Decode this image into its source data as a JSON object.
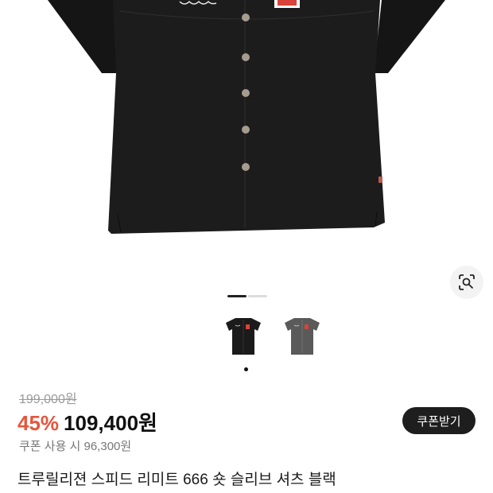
{
  "product": {
    "original_price": "199,000원",
    "discount_rate": "45%",
    "sale_price": "109,400원",
    "coupon_note": "쿠폰 사용 시 96,300원",
    "coupon_button": "쿠폰받기",
    "title": "트루릴리젼 스피드 리미트 666 숏 슬리브 셔츠 블랙"
  },
  "gallery": {
    "active_index": 0,
    "count": 2,
    "thumbnails": [
      {
        "color": "black",
        "hex": "#1b1b1b"
      },
      {
        "color": "gray",
        "hex": "#5a5a5a"
      }
    ]
  },
  "colors": {
    "discount": "#e4573d",
    "button_bg": "#1e1e1e"
  }
}
